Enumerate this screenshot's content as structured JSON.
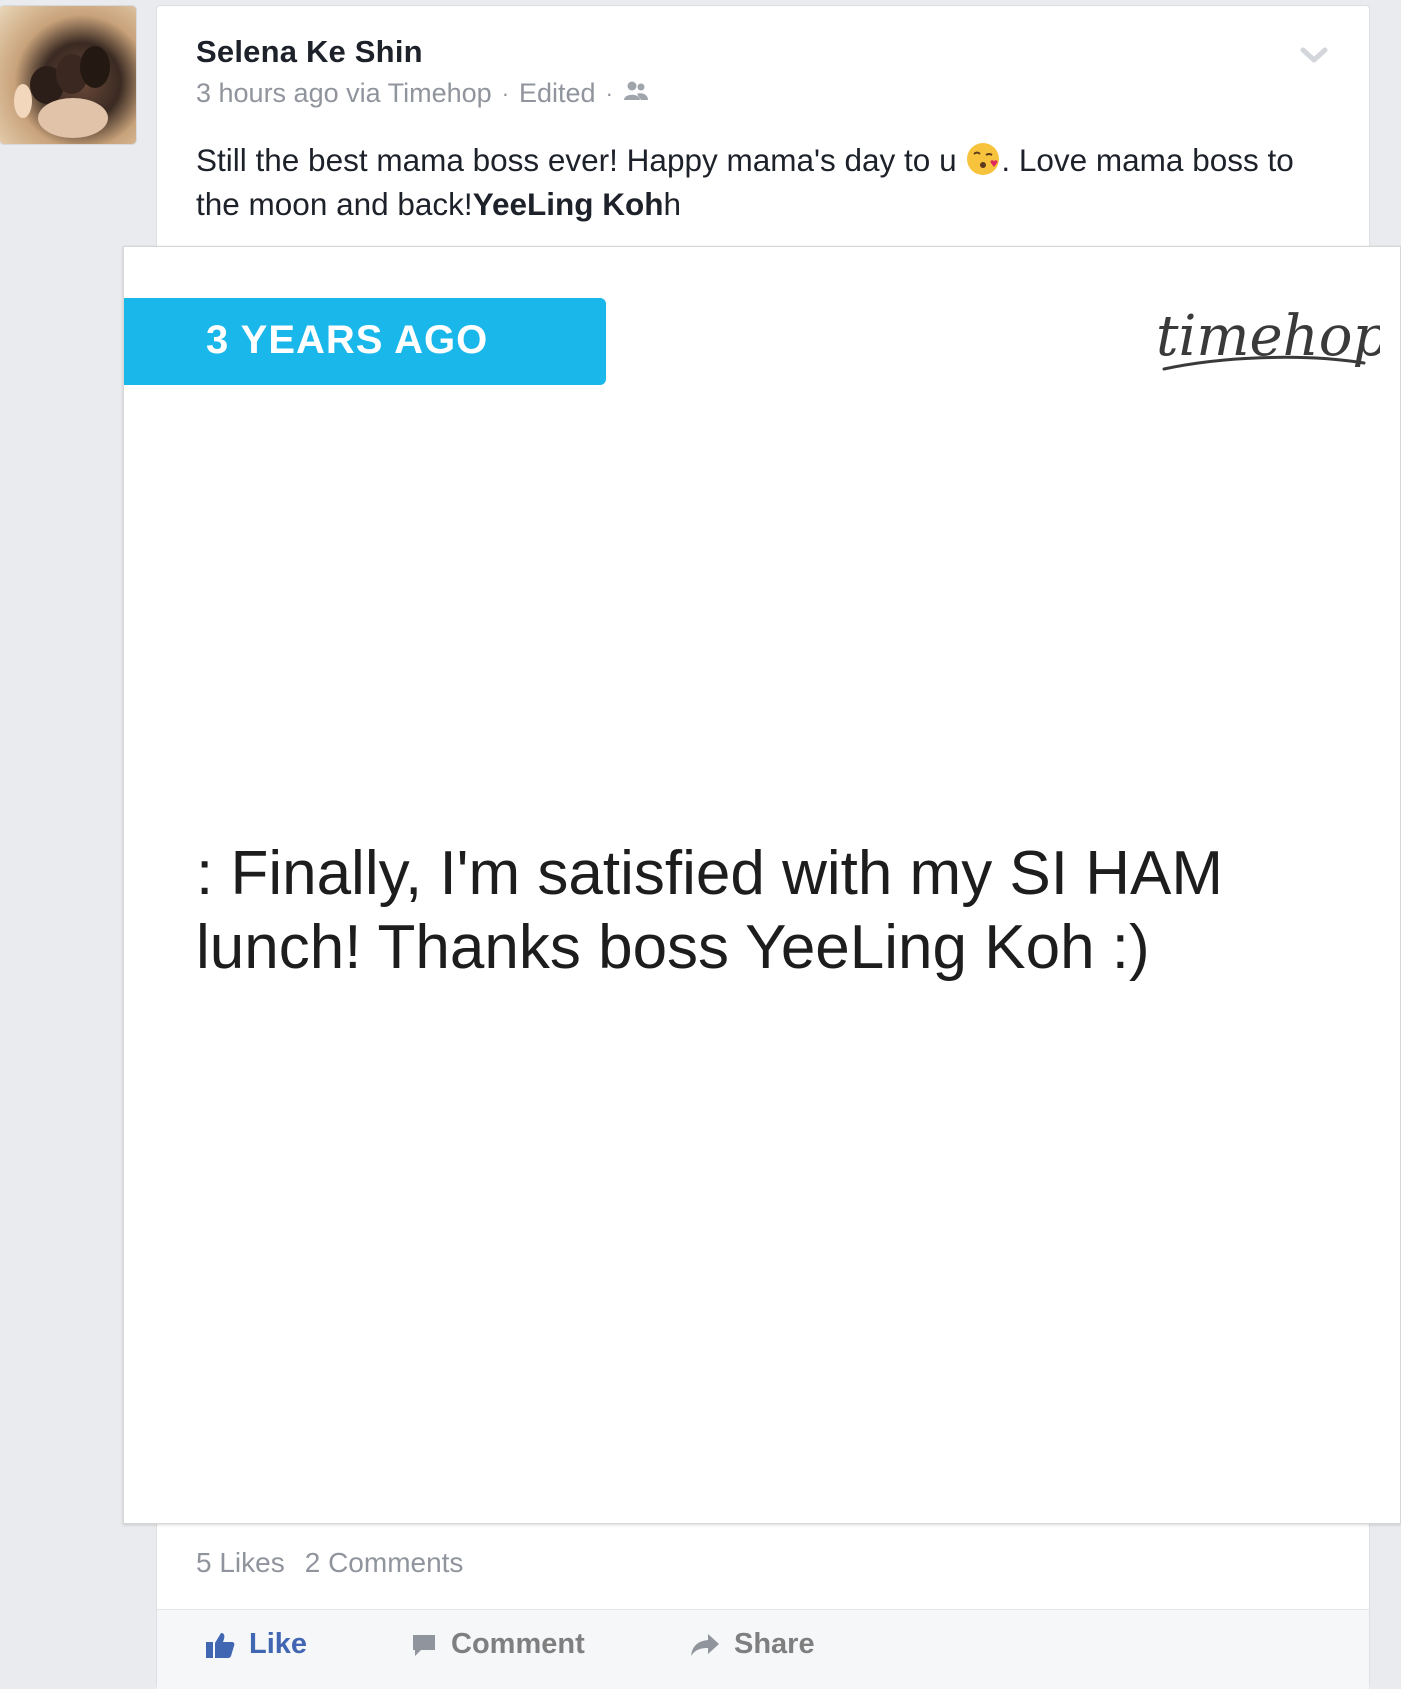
{
  "post": {
    "author": "Selena Ke Shin",
    "timestamp": "3 hours ago via Timehop",
    "edited_label": "Edited",
    "separator": "·",
    "audience_icon": "friends-icon",
    "text_part1": "Still the best mama boss ever! Happy mama's day to u ",
    "emoji": "kissing-face-emoji",
    "text_part2": ". Love mama boss to the moon and back!",
    "mention": "YeeLing Koh",
    "text_part3": "h"
  },
  "timehop_card": {
    "badge": "3 YEARS AGO",
    "brand": "timehop",
    "memory_text": ": Finally, I'm satisfied with my SI HAM lunch! Thanks boss YeeLing Koh :)",
    "badge_color": "#1ab7ea"
  },
  "stats": {
    "likes": "5 Likes",
    "comments": "2 Comments"
  },
  "actions": {
    "like": "Like",
    "comment": "Comment",
    "share": "Share"
  },
  "colors": {
    "background": "#e9ebee",
    "link_blue": "#4267b2",
    "meta_grey": "#90949c"
  }
}
